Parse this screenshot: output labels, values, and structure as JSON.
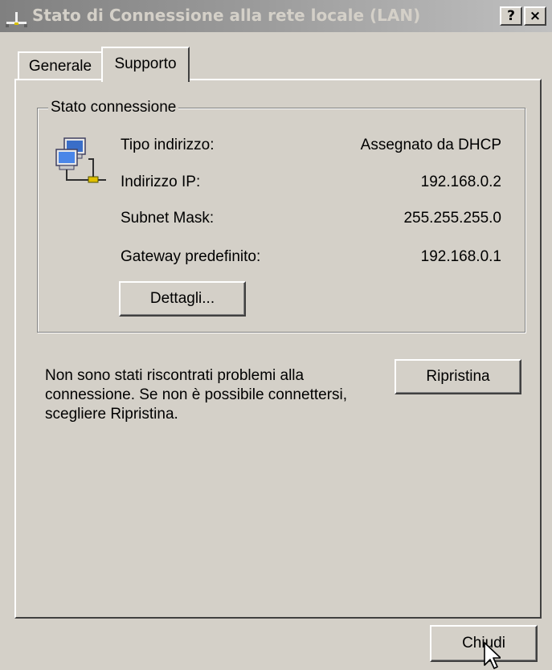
{
  "window": {
    "title": "Stato di Connessione alla rete locale (LAN)",
    "help_glyph": "?",
    "close_glyph": "×",
    "title_icon": "network-connection-icon"
  },
  "tabs": [
    {
      "label": "Generale",
      "selected": false
    },
    {
      "label": "Supporto",
      "selected": true
    }
  ],
  "status_group": {
    "label": "Stato connessione",
    "icon": "network-computers-icon",
    "rows": [
      {
        "label": "Tipo indirizzo:",
        "value": "Assegnato da DHCP"
      },
      {
        "label": "Indirizzo IP:",
        "value": "192.168.0.2"
      },
      {
        "label": "Subnet Mask:",
        "value": "255.255.255.0"
      },
      {
        "label": "Gateway predefinito:",
        "value": "192.168.0.1"
      }
    ],
    "details_button": "Dettagli..."
  },
  "repair": {
    "message": "Non sono stati riscontrati problemi alla connessione. Se non è possibile connettersi, scegliere Ripristina.",
    "button": "Ripristina"
  },
  "footer": {
    "close_button": "Chiudi"
  },
  "colors": {
    "face": "#d4d0c8",
    "title_start": "#808080",
    "title_end": "#c0c0c0",
    "title_text": "#d4d0c8"
  }
}
